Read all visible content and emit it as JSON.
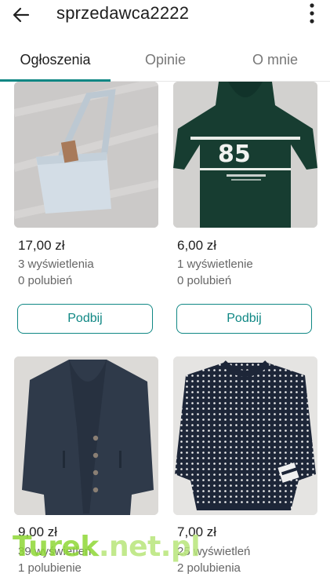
{
  "header": {
    "title": "sprzedawca2222"
  },
  "tabs": [
    {
      "label": "Ogłoszenia",
      "active": true
    },
    {
      "label": "Opinie",
      "active": false
    },
    {
      "label": "O mnie",
      "active": false
    }
  ],
  "listings": [
    {
      "price": "17,00 zł",
      "views": "3 wyświetlenia",
      "likes": "0 polubień",
      "button": "Podbij",
      "image": "light-blue-crossbody-bag"
    },
    {
      "price": "6,00 zł",
      "views": "1 wyświetlenie",
      "likes": "0 polubień",
      "button": "Podbij",
      "image": "green-hoodie-85"
    },
    {
      "price": "9,00 zł",
      "views": "39 wyświetleń",
      "likes": "1 polubienie",
      "image": "navy-shawl-collar-cardigan"
    },
    {
      "price": "7,00 zł",
      "views": "25 wyświetleń",
      "likes": "2 polubienia",
      "image": "navy-white-knit-sweater"
    }
  ],
  "hoodie_print": "85",
  "watermark": {
    "part1": "Turek",
    "part2": ".net.pl"
  },
  "colors": {
    "accent": "#0f8784",
    "text": "#1e1e1e",
    "muted": "#666666"
  }
}
